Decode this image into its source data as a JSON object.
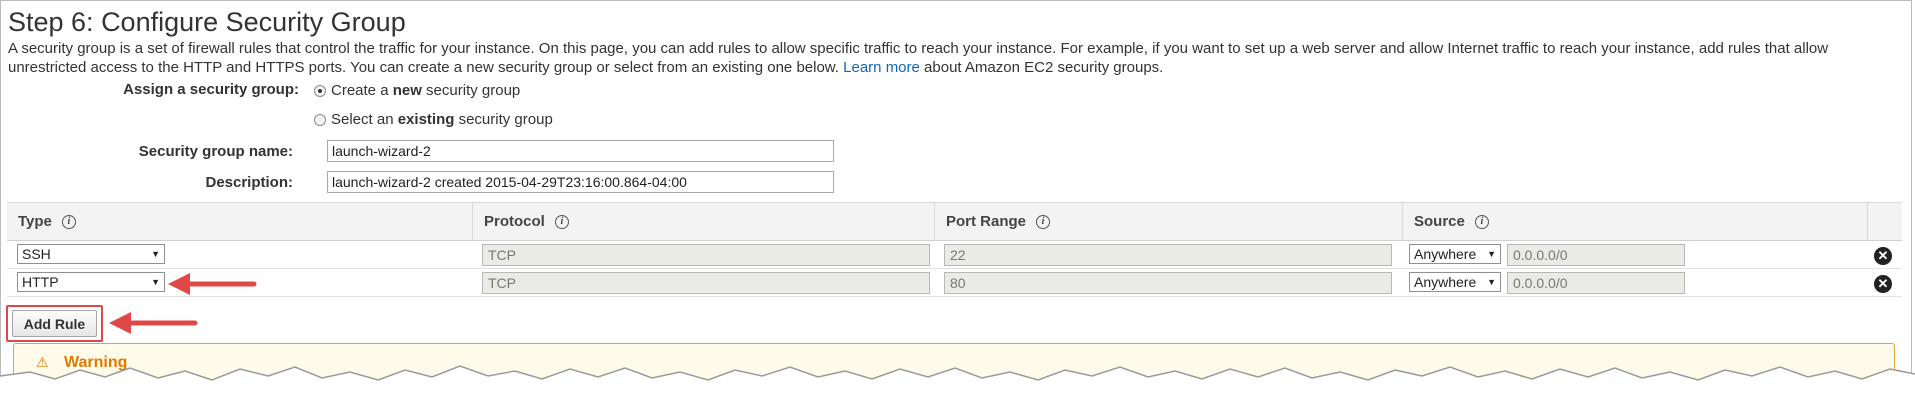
{
  "page": {
    "title": "Step 6: Configure Security Group",
    "description_text": "A security group is a set of firewall rules that control the traffic for your instance. On this page, you can add rules to allow specific traffic to reach your instance. For example, if you want to set up a web server and allow Internet traffic to reach your instance, add rules that allow unrestricted access to the HTTP and HTTPS ports. You can create a new security group or select from an existing one below.",
    "learn_more": "Learn more",
    "learn_more_suffix": "about Amazon EC2 security groups."
  },
  "assign": {
    "label": "Assign a security group:",
    "option_new_pre": "Create a ",
    "option_new_bold": "new",
    "option_new_post": " security group",
    "option_existing_pre": "Select an ",
    "option_existing_bold": "existing",
    "option_existing_post": " security group",
    "selected": "new"
  },
  "form": {
    "name_label": "Security group name:",
    "name_value": "launch-wizard-2",
    "description_label": "Description:",
    "description_value": "launch-wizard-2 created 2015-04-29T23:16:00.864-04:00"
  },
  "table": {
    "headers": [
      "Type",
      "Protocol",
      "Port Range",
      "Source"
    ],
    "info_glyph": "i",
    "rows": [
      {
        "type": "SSH",
        "protocol": "TCP",
        "port": "22",
        "source": "Anywhere",
        "cidr": "0.0.0.0/0"
      },
      {
        "type": "HTTP",
        "protocol": "TCP",
        "port": "80",
        "source": "Anywhere",
        "cidr": "0.0.0.0/0"
      }
    ],
    "remove_glyph": "✕"
  },
  "actions": {
    "add_rule": "Add Rule"
  },
  "warning": {
    "icon": "⚠",
    "title": "Warning"
  },
  "colors": {
    "link": "#1166bb",
    "annotation": "#e04848",
    "warning": "#e07b00"
  },
  "icons": {
    "info": "info-circle-icon",
    "remove": "remove-circle-icon",
    "dropdown": "chevron-down-icon",
    "warning": "warning-triangle-icon"
  }
}
